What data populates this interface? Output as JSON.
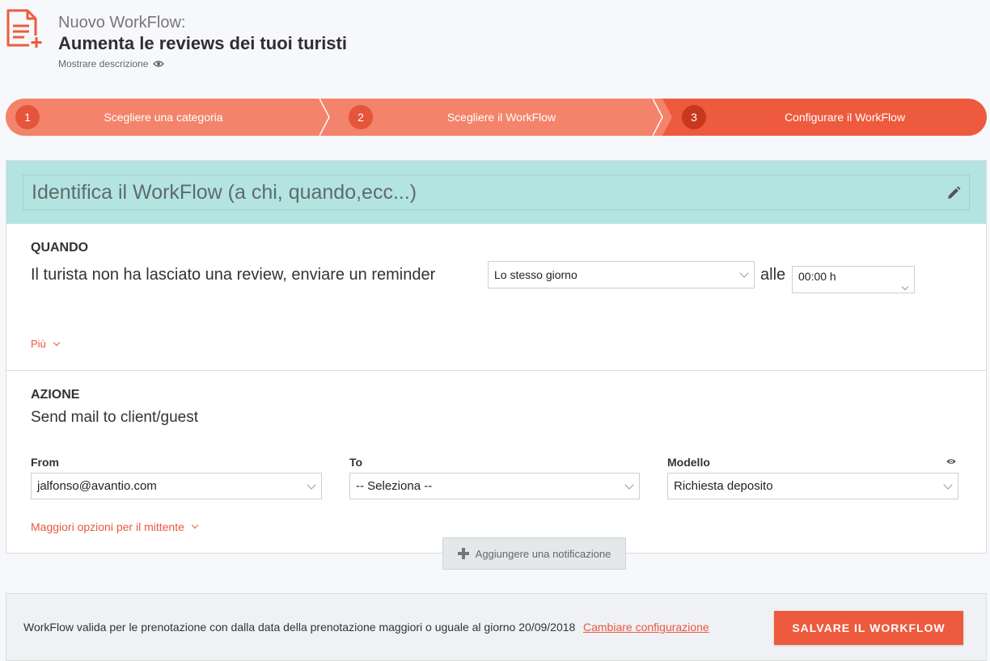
{
  "header": {
    "subtitle": "Nuovo WorkFlow:",
    "title": "Aumenta le reviews dei tuoi turisti",
    "description_toggle": "Mostrare descrizione",
    "icon": "document-add-icon",
    "accent_color": "#ee5a3d"
  },
  "stepper": {
    "steps": [
      {
        "number": "1",
        "label": "Scegliere una categoria"
      },
      {
        "number": "2",
        "label": "Scegliere il WorkFlow"
      },
      {
        "number": "3",
        "label": "Configurare il WorkFlow",
        "active": true
      }
    ]
  },
  "identify": {
    "placeholder": "Identifica il WorkFlow (a chi, quando,ecc...)",
    "value": ""
  },
  "quando": {
    "label": "QUANDO",
    "sentence": "Il turista non ha lasciato una review, enviare un reminder",
    "day_select": "Lo stesso giorno",
    "at_label": "alle",
    "time_select": "00:00 h",
    "more_link": "Più"
  },
  "azione": {
    "label": "AZIONE",
    "action_text": "Send mail to client/guest",
    "from_label": "From",
    "from_value": "jalfonso@avantio.com",
    "to_label": "To",
    "to_value": "-- Seleziona --",
    "model_label": "Modello",
    "model_value": "Richiesta deposito",
    "sender_options_link": "Maggiori opzioni per il mittente"
  },
  "add_notification": "Aggiungere una notificazione",
  "footer": {
    "text": "WorkFlow valida per le prenotazione con dalla data della prenotazione maggiori o uguale al giorno 20/09/2018",
    "change_link": "Cambiare configurazione",
    "save_button": "SALVARE IL WORKFLOW"
  }
}
